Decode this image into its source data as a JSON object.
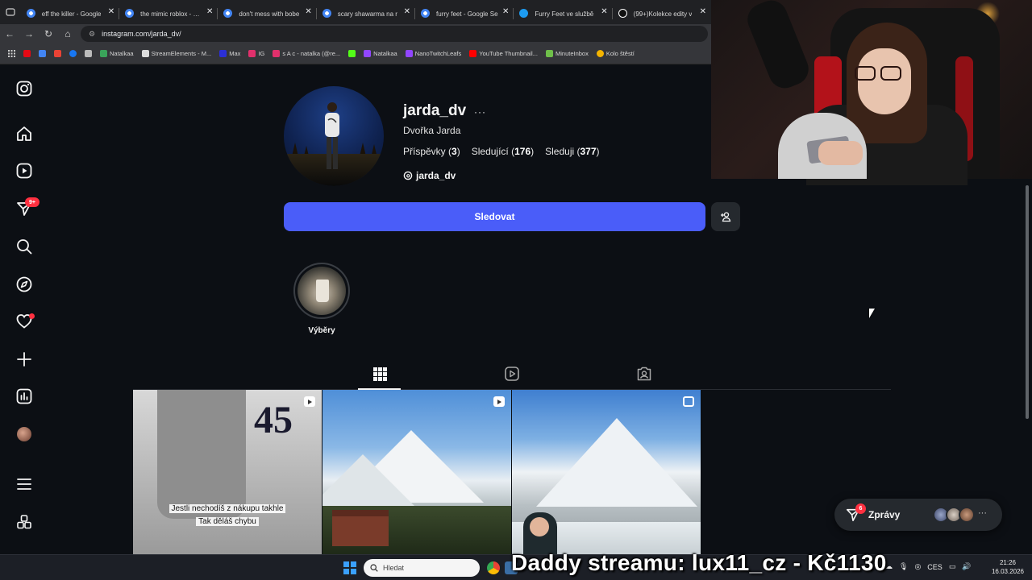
{
  "browser": {
    "tabs": [
      {
        "label": "eff the killer - Google",
        "favicon": "google"
      },
      {
        "label": "the mimic roblox - Goo",
        "favicon": "google"
      },
      {
        "label": "don't mess with bobe",
        "favicon": "google"
      },
      {
        "label": "scary shawarma na r",
        "favicon": "google"
      },
      {
        "label": "furry feet - Google Se",
        "favicon": "google"
      },
      {
        "label": "Furry Feet ve službě",
        "favicon": "twitter"
      },
      {
        "label": "(99+)Kolekce edity v",
        "favicon": "tiktok"
      }
    ],
    "url": "instagram.com/jarda_dv/",
    "bookmarks": [
      {
        "label": "",
        "color": "#e50914"
      },
      {
        "label": "",
        "color": "#4285f4"
      },
      {
        "label": "",
        "color": "#ea4335"
      },
      {
        "label": "",
        "color": "#1877f2"
      },
      {
        "label": "",
        "color": "#bbbbbb"
      },
      {
        "label": "Natalkaa",
        "color": "#3aa35a"
      },
      {
        "label": "StreamElements - M...",
        "color": "#dddddd"
      },
      {
        "label": "Max",
        "color": "#2b2fd6"
      },
      {
        "label": "IG",
        "color": "#e1306c"
      },
      {
        "label": "s A c - natalka (@re...",
        "color": "#e1306c"
      },
      {
        "label": "",
        "color": "#53fc18"
      },
      {
        "label": "Natalkaa",
        "color": "#9146ff"
      },
      {
        "label": "NanoTwitchLeafs",
        "color": "#9146ff"
      },
      {
        "label": "YouTube Thumbnail...",
        "color": "#ff0000"
      },
      {
        "label": "MinuteInbox",
        "color": "#6fbf4a"
      },
      {
        "label": "Kolo štěstí",
        "color": "#f4b400"
      }
    ]
  },
  "sidebar": {
    "icons": [
      "instagram-logo-icon",
      "home-icon",
      "reels-icon",
      "messages-icon",
      "search-icon",
      "explore-icon",
      "heart-icon",
      "create-icon",
      "dashboard-icon",
      "profile-avatar",
      "menu-icon",
      "apps-icon"
    ],
    "messages_badge": "9+"
  },
  "profile": {
    "username": "jarda_dv",
    "full_name": "Dvořka Jarda",
    "posts_label": "Příspěvky",
    "posts_count": "3",
    "followers_label": "Sledující",
    "followers_count": "176",
    "following_label": "Sleduji",
    "following_count": "377",
    "threads_handle": "jarda_dv",
    "follow_button": "Sledovat"
  },
  "highlights": [
    {
      "label": "Výběry"
    }
  ],
  "posts": [
    {
      "type": "reel",
      "caption_line1": "Jestli nechodíš z nákupu takhle",
      "caption_line2": "Tak děláš chybu"
    },
    {
      "type": "reel"
    },
    {
      "type": "carousel"
    }
  ],
  "messages_pill": {
    "label": "Zprávy",
    "badge": "6"
  },
  "taskbar": {
    "search_placeholder": "Hledat",
    "language": "CES",
    "time": "21:26",
    "date": "16.03.2026"
  },
  "overlay": {
    "donation_text": "Daddy streamu: lux11_cz - Kč1130"
  },
  "colors": {
    "follow_button": "#4a5df9",
    "badge": "#ff3040",
    "page_bg": "#0c0f14"
  }
}
